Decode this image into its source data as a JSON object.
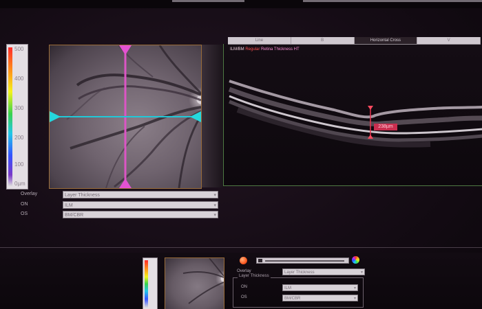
{
  "left_panel": {
    "thickness_scale": {
      "ticks": [
        "500",
        "400",
        "300",
        "200",
        "100",
        "0µm"
      ],
      "colors": [
        "#ff2b2b",
        "#ff9a1a",
        "#f4f31b",
        "#38d24e",
        "#22c7e8",
        "#3553ff",
        "#7a39c8"
      ]
    },
    "fields": [
      {
        "label": "Overlay",
        "value": "Layer Thickness"
      },
      {
        "label": "ON",
        "value": "ILM"
      },
      {
        "label": "OS",
        "value": "BM/CBR"
      }
    ]
  },
  "right_panel": {
    "tabs": [
      "Line",
      "B",
      "Horizontal Cross",
      "V"
    ],
    "active_tab": "Horizontal Cross",
    "legend": {
      "prefix": "ILM/BM",
      "item1": "Regular",
      "item2": "Retina Thickness HT"
    },
    "measurement": "238µm"
  },
  "lower_panel": {
    "overlay_label": "Overlay",
    "overlay_value": "Layer Thickness",
    "group_title": "Layer Thickness",
    "rows": [
      {
        "label": "ON",
        "value": "ILM"
      },
      {
        "label": "OS",
        "value": "BM/CBR"
      }
    ]
  }
}
